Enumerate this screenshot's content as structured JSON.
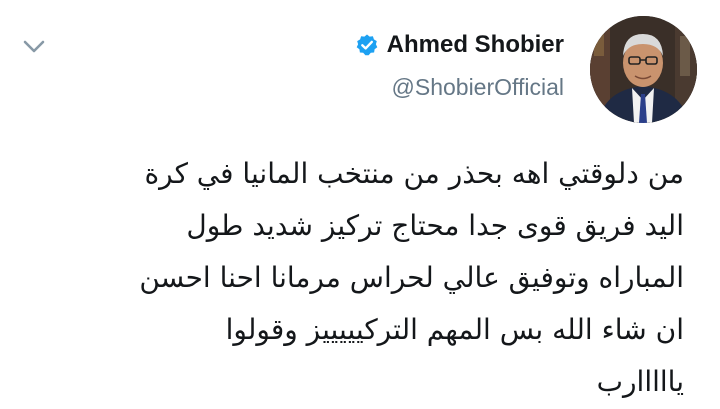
{
  "tweet": {
    "author": {
      "display_name": "Ahmed Shobier",
      "handle": "@ShobierOfficial",
      "verified": true
    },
    "text": "من دلوقتي اهه بحذر من منتخب المانيا في كرة\nاليد فريق قوى جدا محتاج تركيز شديد طول\nالمباراه وتوفيق عالي لحراس مرمانا احنا احسن\nان شاء الله بس المهم التركيييييز وقولوا\nيااااارب",
    "menu_icon": "chevron-down-icon"
  },
  "colors": {
    "verified_blue": "#1da1f2",
    "handle_gray": "#657786",
    "text": "#14171a",
    "chevron": "#8899a6"
  }
}
